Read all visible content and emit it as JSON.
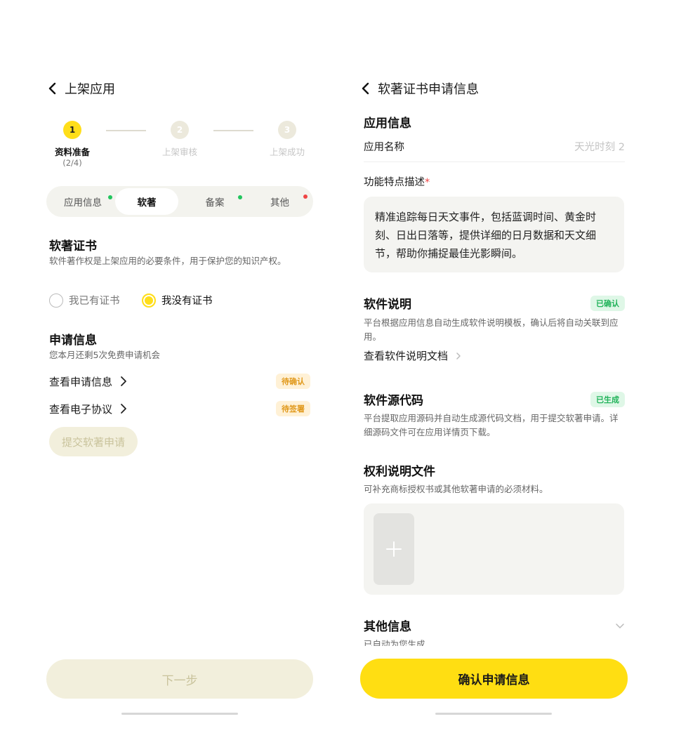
{
  "left": {
    "nav": {
      "title": "上架应用"
    },
    "stepper": [
      {
        "num": "1",
        "label": "资料准备",
        "sub": "(2/4)"
      },
      {
        "num": "2",
        "label": "上架审核"
      },
      {
        "num": "3",
        "label": "上架成功"
      }
    ],
    "tabs": [
      {
        "label": "应用信息",
        "dot": "#22c55e"
      },
      {
        "label": "软著"
      },
      {
        "label": "备案",
        "dot": "#22c55e"
      },
      {
        "label": "其他",
        "dot": "#ef4444"
      }
    ],
    "cert": {
      "title": "软著证书",
      "desc": "软件著作权是上架应用的必要条件，用于保护您的知识产权。",
      "options": [
        "我已有证书",
        "我没有证书"
      ],
      "selected": "我没有证书"
    },
    "apply": {
      "title": "申请信息",
      "desc": "您本月还剩5次免费申请机会",
      "rows": [
        {
          "label": "查看申请信息",
          "badge": "待确认"
        },
        {
          "label": "查看电子协议",
          "badge": "待签署"
        }
      ],
      "submit_label": "提交软著申请"
    },
    "next_label": "下一步"
  },
  "right": {
    "nav": {
      "title": "软著证书申请信息"
    },
    "app_info": {
      "title": "应用信息",
      "name_label": "应用名称",
      "name_value": "天光时刻 2"
    },
    "feature": {
      "label": "功能特点描述",
      "required_mark": "*",
      "text": "精准追踪每日天文事件，包括蓝调时间、黄金时刻、日出日落等，提供详细的日月数据和天文细节，帮助你捕捉最佳光影瞬间。"
    },
    "manual": {
      "title": "软件说明",
      "badge": "已确认",
      "desc": "平台根据应用信息自动生成软件说明模板，确认后将自动关联到应用。",
      "link": "查看软件说明文档"
    },
    "source": {
      "title": "软件源代码",
      "badge": "已生成",
      "desc": "平台提取应用源码并自动生成源代码文档，用于提交软著申请。详细源码文件可在应用详情页下载。"
    },
    "rights": {
      "title": "权利说明文件",
      "desc": "可补充商标授权书或其他软著申请的必须材料。"
    },
    "other": {
      "title": "其他信息",
      "desc": "已自动为您生成"
    },
    "confirm_label": "确认申请信息"
  },
  "colors": {
    "accent": "#ffde12",
    "ok": "#22b35a",
    "pending": "#e0981a"
  }
}
